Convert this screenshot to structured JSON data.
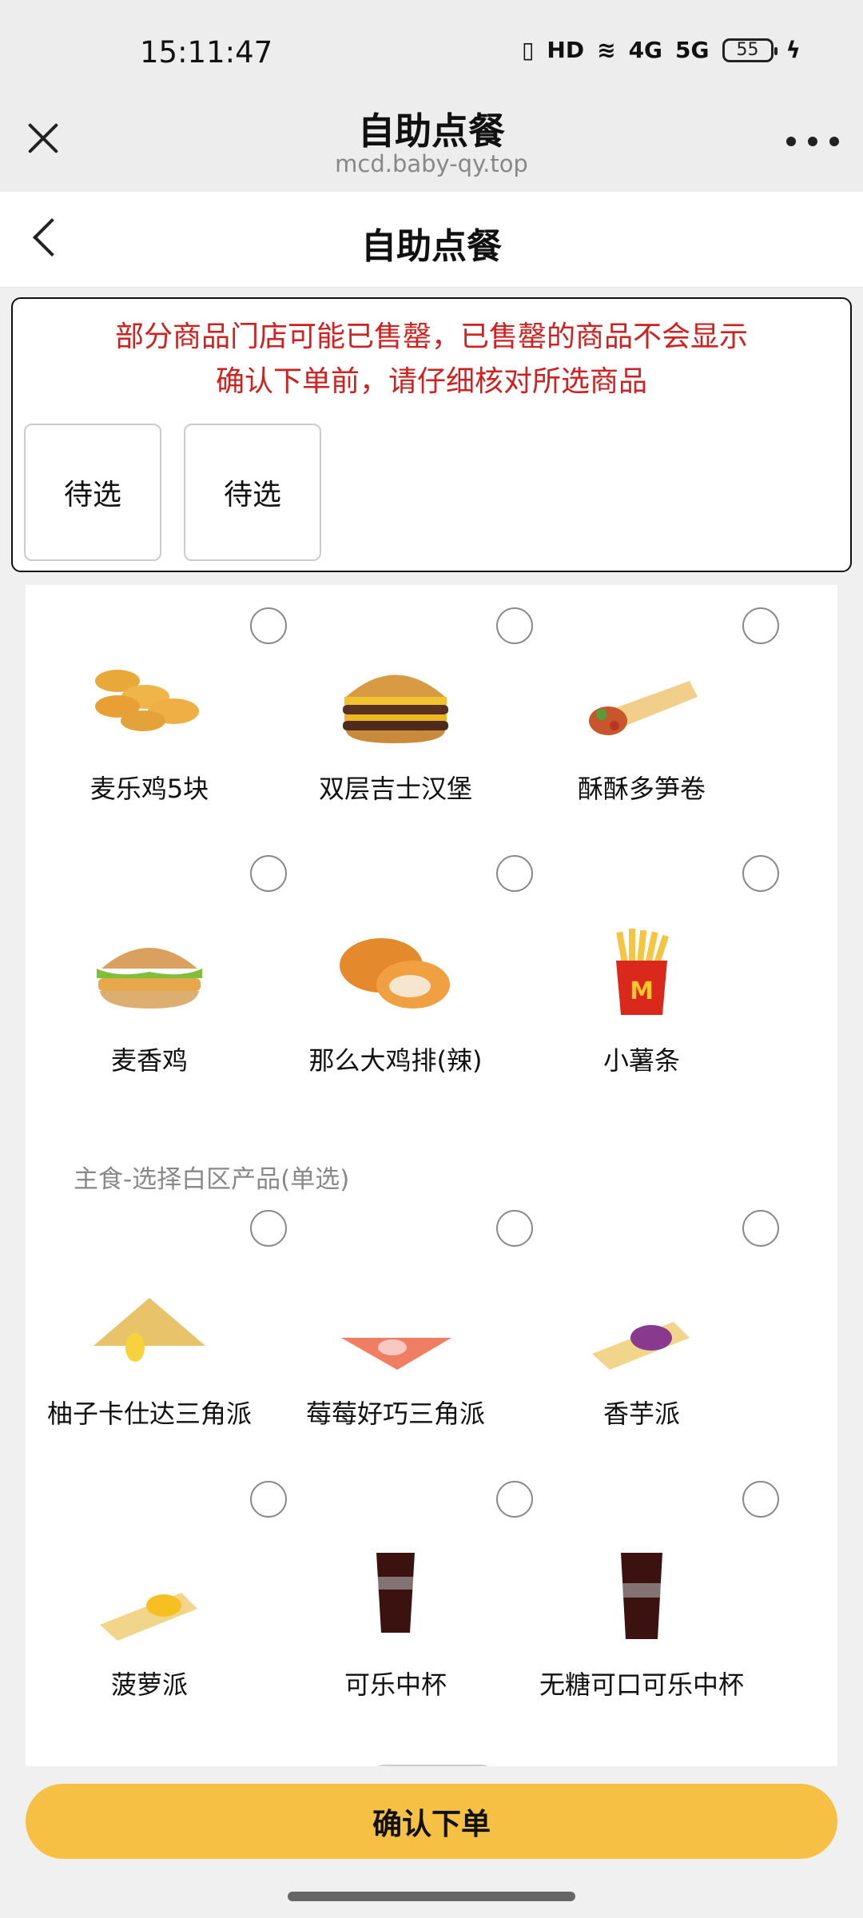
{
  "status_bar": {
    "time": "15:11:47",
    "signal_labels": [
      "HD",
      "4G",
      "5G"
    ],
    "battery": "55"
  },
  "webview": {
    "title": "自助点餐",
    "domain": "mcd.baby-qy.top"
  },
  "page": {
    "title": "自助点餐"
  },
  "notice": {
    "line1": "部分商品门店可能已售罄，已售罄的商品不会显示",
    "line2": "确认下单前，请仔细核对所选商品",
    "slots": [
      "待选",
      "待选"
    ]
  },
  "products": [
    {
      "name": "麦乐鸡5块",
      "icon": "nuggets-icon"
    },
    {
      "name": "双层吉士汉堡",
      "icon": "burger-icon"
    },
    {
      "name": "酥酥多笋卷",
      "icon": "wrap-icon"
    },
    {
      "name": "麦香鸡",
      "icon": "burger-icon"
    },
    {
      "name": "那么大鸡排(辣)",
      "icon": "chicken-cutlet-icon"
    },
    {
      "name": "小薯条",
      "icon": "fries-icon"
    }
  ],
  "section2": {
    "title": "主食-选择白区产品(单选)",
    "products": [
      {
        "name": "柚子卡仕达三角派",
        "icon": "triangle-pie-icon"
      },
      {
        "name": "莓莓好巧三角派",
        "icon": "triangle-pie-icon"
      },
      {
        "name": "香芋派",
        "icon": "pie-icon"
      },
      {
        "name": "菠萝派",
        "icon": "pie-icon"
      },
      {
        "name": "可乐中杯",
        "icon": "cola-icon"
      },
      {
        "name": "无糖可口可乐中杯",
        "icon": "cola-icon"
      }
    ]
  },
  "footer": {
    "confirm_label": "确认下单"
  }
}
